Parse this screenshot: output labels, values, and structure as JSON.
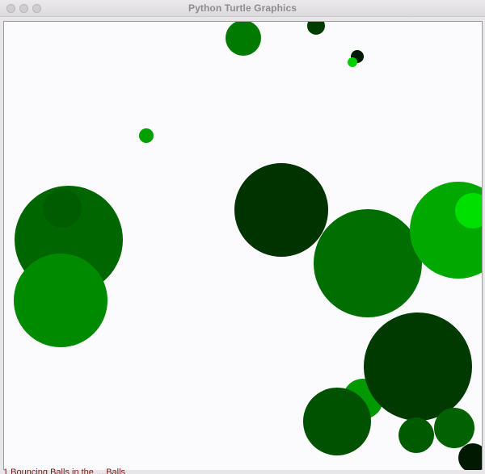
{
  "window": {
    "title": "Python Turtle Graphics"
  },
  "colors": {
    "background": "#fbfafc",
    "shades": [
      "#003300",
      "#004d00",
      "#005c00",
      "#006600",
      "#007300",
      "#008000",
      "#008c00",
      "#00a300",
      "#00b200",
      "#00e600"
    ]
  },
  "balls": [
    {
      "color": "#006600"
    },
    {
      "color": "#005c00"
    },
    {
      "color": "#008a00"
    },
    {
      "color": "#003300"
    },
    {
      "color": "#006e00"
    },
    {
      "color": "#00a800"
    },
    {
      "color": "#00e000"
    },
    {
      "color": "#007a00"
    },
    {
      "color": "#003d00"
    },
    {
      "color": "#001a00"
    },
    {
      "color": "#00d000"
    },
    {
      "color": "#00a000"
    },
    {
      "color": "#009900"
    },
    {
      "color": "#003a00"
    },
    {
      "color": "#005200"
    },
    {
      "color": "#006200"
    },
    {
      "color": "#005a00"
    },
    {
      "color": "#001900"
    }
  ],
  "status": {
    "text": "1 Bouncing Balls in the ... Balls"
  }
}
